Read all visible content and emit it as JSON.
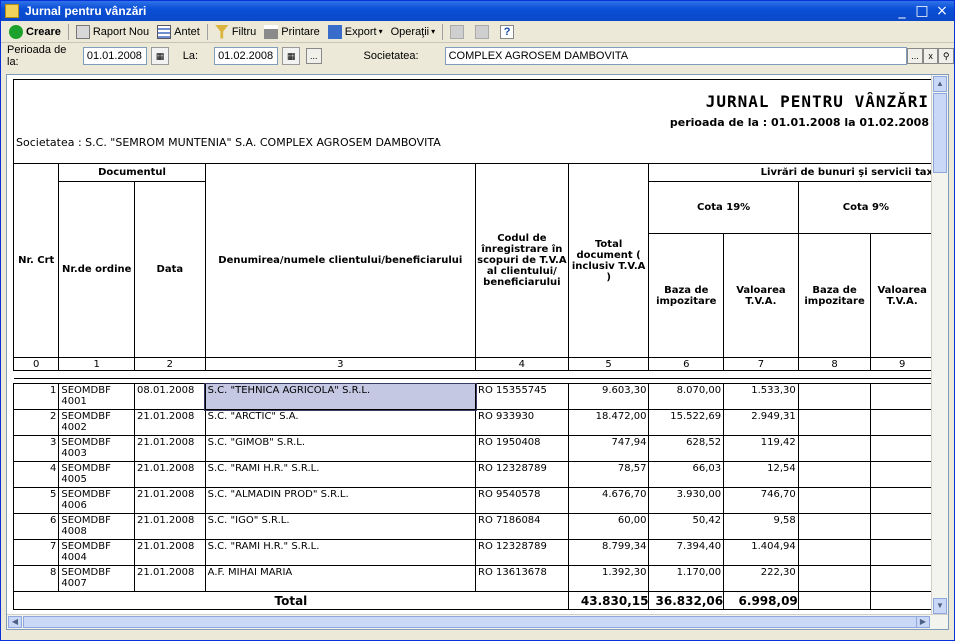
{
  "window": {
    "title": "Jurnal pentru vânzări"
  },
  "toolbar": {
    "create": "Creare",
    "new_report": "Raport Nou",
    "header": "Antet",
    "filter": "Filtru",
    "print": "Printare",
    "export": "Export",
    "operations": "Operaţii",
    "help": "?"
  },
  "filters": {
    "period_from_label": "Perioada de la:",
    "period_from": "01.01.2008",
    "to_label": "La:",
    "period_to": "01.02.2008",
    "ellipsis": "...",
    "company_label": "Societatea:",
    "company_value": "COMPLEX AGROSEM DAMBOVITA",
    "clear": "x"
  },
  "report": {
    "title": "JURNAL PENTRU VÂNZĂRI",
    "period": "perioada de la : 01.01.2008 la 01.02.2008",
    "company": "Societatea : S.C. \"SEMROM MUNTENIA\" S.A. COMPLEX AGROSEM DAMBOVITA",
    "headers": {
      "nr_crt": "Nr. Crt",
      "document": "Documentul",
      "nr_ordine": "Nr.de ordine",
      "data": "Data",
      "client": "Denumirea/numele clientului/beneficiarului",
      "cod_tva": "Codul de înregistrare în scopuri de T.V.A al clientului/ beneficiarului",
      "total_doc": "Total document ( inclusiv T.V.A )",
      "livrari": "Livrări de bunuri şi servicii tax",
      "cota19": "Cota 19%",
      "cota9": "Cota 9%",
      "baza": "Baza de impozitare",
      "valoarea": "Valoarea T.V.A.",
      "baza9": "Baza de impozitare",
      "valoarea9": "Valoarea T.V.A."
    },
    "col_numbers": [
      "0",
      "1",
      "2",
      "3",
      "4",
      "5",
      "6",
      "7",
      "8",
      "9"
    ],
    "rows": [
      {
        "nr": "1",
        "doc": "SEOMDBF 4001",
        "date": "08.01.2008",
        "client": "S.C. \"TEHNICA AGRICOLA\" S.R.L.",
        "cod": "RO 15355745",
        "total": "9.603,30",
        "baza": "8.070,00",
        "tva": "1.533,30"
      },
      {
        "nr": "2",
        "doc": "SEOMDBF 4002",
        "date": "21.01.2008",
        "client": "S.C. \"ARCTIC\" S.A.",
        "cod": "RO 933930",
        "total": "18.472,00",
        "baza": "15.522,69",
        "tva": "2.949,31"
      },
      {
        "nr": "3",
        "doc": "SEOMDBF 4003",
        "date": "21.01.2008",
        "client": "S.C. \"GIMOB\" S.R.L.",
        "cod": "RO 1950408",
        "total": "747,94",
        "baza": "628,52",
        "tva": "119,42"
      },
      {
        "nr": "4",
        "doc": "SEOMDBF 4005",
        "date": "21.01.2008",
        "client": "S.C. \"RAMI H.R.\" S.R.L.",
        "cod": "RO 12328789",
        "total": "78,57",
        "baza": "66,03",
        "tva": "12,54"
      },
      {
        "nr": "5",
        "doc": "SEOMDBF 4006",
        "date": "21.01.2008",
        "client": "S.C. \"ALMADIN PROD\" S.R.L.",
        "cod": "RO 9540578",
        "total": "4.676,70",
        "baza": "3.930,00",
        "tva": "746,70"
      },
      {
        "nr": "6",
        "doc": "SEOMDBF 4008",
        "date": "21.01.2008",
        "client": "S.C. \"IGO\" S.R.L.",
        "cod": "RO 7186084",
        "total": "60,00",
        "baza": "50,42",
        "tva": "9,58"
      },
      {
        "nr": "7",
        "doc": "SEOMDBF 4004",
        "date": "21.01.2008",
        "client": "S.C. \"RAMI H.R.\" S.R.L.",
        "cod": "RO 12328789",
        "total": "8.799,34",
        "baza": "7.394,40",
        "tva": "1.404,94"
      },
      {
        "nr": "8",
        "doc": "SEOMDBF 4007",
        "date": "21.01.2008",
        "client": "A.F. MIHAI MARIA",
        "cod": "RO 13613678",
        "total": "1.392,30",
        "baza": "1.170,00",
        "tva": "222,30"
      }
    ],
    "totals": {
      "label": "Total",
      "total": "43.830,15",
      "baza": "36.832,06",
      "tva": "6.998,09"
    }
  }
}
